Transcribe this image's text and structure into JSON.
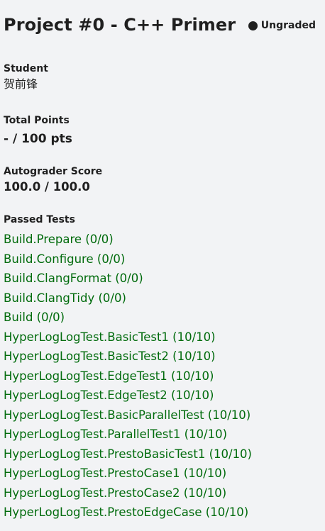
{
  "header": {
    "title": "Project #0 - C++ Primer",
    "status": "Ungraded"
  },
  "student": {
    "label": "Student",
    "value": "贺前锋"
  },
  "total_points": {
    "label": "Total Points",
    "value": "- / 100 pts"
  },
  "autograder": {
    "label": "Autograder Score",
    "value": "100.0 / 100.0"
  },
  "passed_tests": {
    "label": "Passed Tests",
    "items": [
      "Build.Prepare (0/0)",
      "Build.Configure (0/0)",
      "Build.ClangFormat (0/0)",
      "Build.ClangTidy (0/0)",
      "Build (0/0)",
      "HyperLogLogTest.BasicTest1 (10/10)",
      "HyperLogLogTest.BasicTest2 (10/10)",
      "HyperLogLogTest.EdgeTest1 (10/10)",
      "HyperLogLogTest.EdgeTest2 (10/10)",
      "HyperLogLogTest.BasicParallelTest (10/10)",
      "HyperLogLogTest.ParallelTest1 (10/10)",
      "HyperLogLogTest.PrestoBasicTest1 (10/10)",
      "HyperLogLogTest.PrestoCase1 (10/10)",
      "HyperLogLogTest.PrestoCase2 (10/10)",
      "HyperLogLogTest.PrestoEdgeCase (10/10)"
    ]
  },
  "colors": {
    "background": "#f2f3f5",
    "text": "#1f1f1f",
    "link": "#006b0c"
  }
}
